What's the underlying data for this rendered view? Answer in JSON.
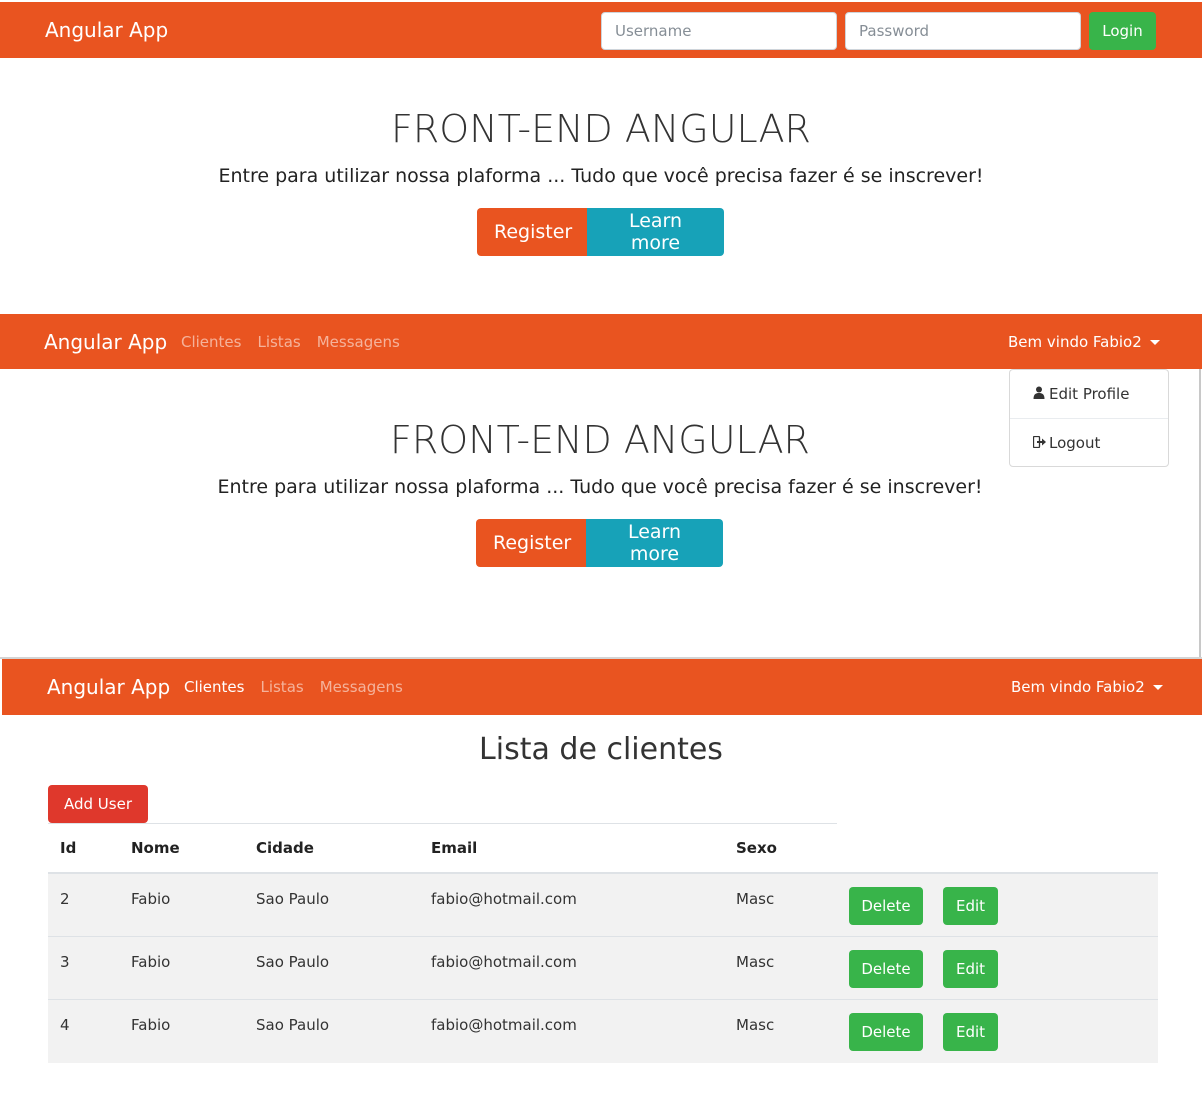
{
  "brand": "Angular App",
  "login_bar": {
    "username_placeholder": "Username",
    "password_placeholder": "Password",
    "login_label": "Login"
  },
  "nav": {
    "items": [
      "Clientes",
      "Listas",
      "Messagens"
    ],
    "welcome": "Bem vindo Fabio2"
  },
  "hero": {
    "title": "FRONT-END ANGULAR",
    "lead": "Entre para utilizar nossa plaforma ... Tudo que você precisa fazer é se inscrever!",
    "register_label": "Register",
    "learn_label": "Learn more"
  },
  "dropdown": {
    "edit_profile": "Edit Profile",
    "logout": "Logout"
  },
  "clients": {
    "title": "Lista de clientes",
    "add_user_label": "Add User",
    "columns": [
      "Id",
      "Nome",
      "Cidade",
      "Email",
      "Sexo"
    ],
    "rows": [
      {
        "id": "2",
        "nome": "Fabio",
        "cidade": "Sao Paulo",
        "email": "fabio@hotmail.com",
        "sexo": "Masc"
      },
      {
        "id": "3",
        "nome": "Fabio",
        "cidade": "Sao Paulo",
        "email": "fabio@hotmail.com",
        "sexo": "Masc"
      },
      {
        "id": "4",
        "nome": "Fabio",
        "cidade": "Sao Paulo",
        "email": "fabio@hotmail.com",
        "sexo": "Masc"
      }
    ],
    "delete_label": "Delete",
    "edit_label": "Edit"
  },
  "colors": {
    "primary": "#e95420",
    "info": "#17a2b8",
    "success": "#38b44a",
    "danger": "#df382c"
  }
}
